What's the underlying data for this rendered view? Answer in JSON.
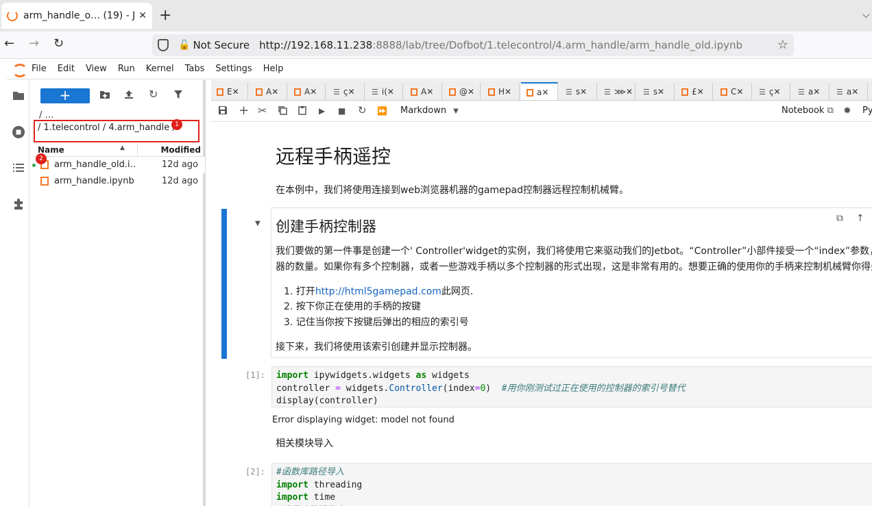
{
  "browser": {
    "tab_title": "arm_handle_o… (19) - Ju",
    "tab_close": "✕",
    "new_tab": "+",
    "tab_menu": "⌵",
    "back": "←",
    "forward": "→",
    "reload": "↻",
    "not_secure": "Not Secure",
    "url_host": "http://192.168.11.238",
    "url_path": ":8888/lab/tree/Dofbot/1.telecontrol/4.arm_handle/arm_handle_old.ipynb",
    "star": "☆"
  },
  "menubar": {
    "items": [
      "File",
      "Edit",
      "View",
      "Run",
      "Kernel",
      "Tabs",
      "Settings",
      "Help"
    ]
  },
  "filebrowser": {
    "new_label": "+",
    "crumbs_top": "/ …",
    "crumbs": "/ 1.telecontrol / 4.arm_handle /",
    "badge1": "1",
    "badge2": "2",
    "col_name": "Name",
    "col_modified": "Modified",
    "files": [
      {
        "name": "arm_handle_old.i…",
        "modified": "12d ago"
      },
      {
        "name": "arm_handle.ipynb",
        "modified": "12d ago"
      }
    ]
  },
  "dock_tabs": [
    "E✕",
    "A✕",
    "A✕",
    "ç✕",
    "i(✕",
    "A✕",
    "@✕",
    "H✕",
    "a✕",
    "s✕",
    "⋙✕",
    "s✕",
    "£✕",
    "C✕",
    "ç✕",
    "a✕",
    "a✕"
  ],
  "notebook": {
    "cell_type": "Markdown",
    "kernel_label": "Notebook",
    "kernel_short": "Py",
    "title": "远程手柄遥控",
    "intro": "在本例中，我们将使用连接到web浏览器机器的gamepad控制器远程控制机械臂。",
    "h2": "创建手柄控制器",
    "para1": "我们要做的第一件事是创建一个' Controller'widget的实例，我们将使用它来驱动我们的Jetbot。“Controller”小部件接受一个“index”参数，该",
    "para2": "器的数量。如果你有多个控制器，或者一些游戏手柄以多个控制器的形式出现，这是非常有用的。想要正确的使用你的手柄来控制机械臂你得先",
    "li1_pre": "1. 打开",
    "li1_link": "http://html5gamepad.com",
    "li1_post": "此网页.",
    "li2": "2. 按下你正在使用的手柄的按键",
    "li3": "3. 记住当你按下按键后弹出的相应的索引号",
    "para3": "接下来，我们将使用该索引创建并显示控制器。",
    "prompt1": "[1]:",
    "prompt2": "[2]:",
    "error": "Error displaying widget: model not found",
    "import_heading": "相关模块导入"
  }
}
